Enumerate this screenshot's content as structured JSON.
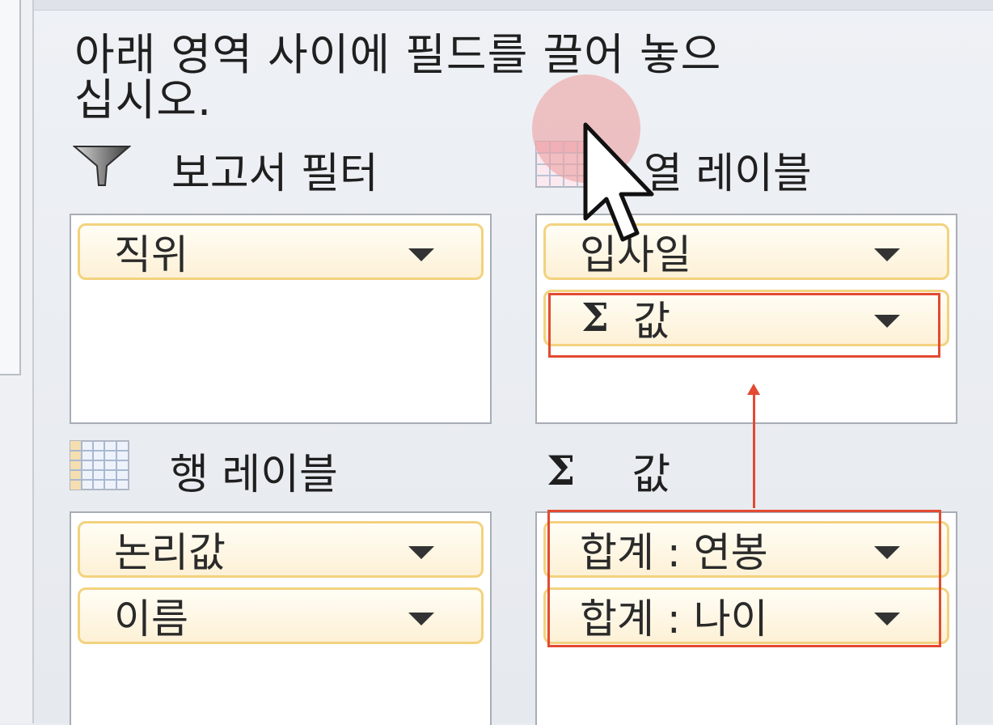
{
  "panel": {
    "instruction": "아래 영역 사이에 필드를 끌어 놓으십시오."
  },
  "areas": {
    "report_filter": {
      "title": "보고서 필터",
      "icon": "filter-icon",
      "fields": [
        "직위"
      ]
    },
    "column_labels": {
      "title": "열 레이블",
      "icon": "column-grid-icon",
      "fields": [
        "입사일",
        "값"
      ]
    },
    "row_labels": {
      "title": "행 레이블",
      "icon": "row-grid-icon",
      "fields": [
        "논리값",
        "이름"
      ]
    },
    "values": {
      "title": "값",
      "icon": "sigma-icon",
      "sigma": "Σ",
      "fields": [
        "합계 : 연봉",
        "합계 : 나이"
      ]
    }
  },
  "annotation": {
    "highlight_color": "#e24a32",
    "cursor_icon": "mouse-pointer-icon"
  }
}
